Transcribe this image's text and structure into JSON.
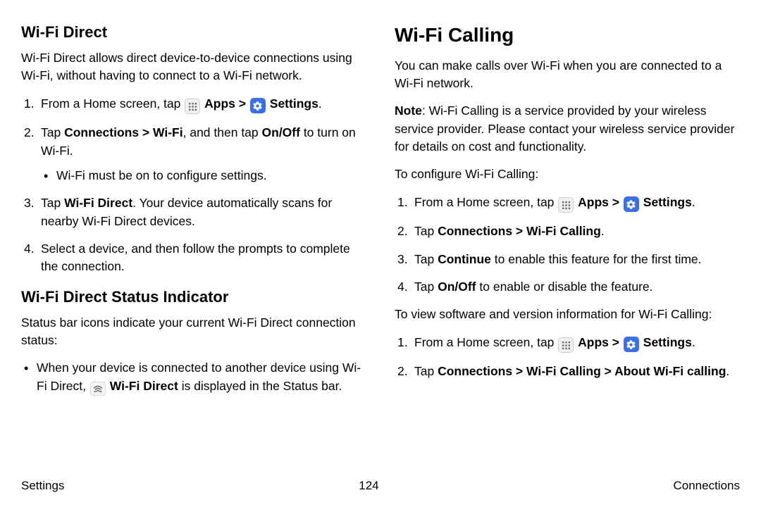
{
  "left": {
    "h_direct": "Wi-Fi Direct",
    "direct_intro": "Wi-Fi Direct allows direct device-to-device connections using Wi-Fi, without having to connect to a Wi-Fi network.",
    "step1_a": "From a Home screen, tap ",
    "apps_label": "Apps",
    "gt": ">",
    "settings_label": "Settings",
    "step2_a": "Tap ",
    "step2_b": "Connections > Wi-Fi",
    "step2_c": ", and then tap ",
    "step2_d": "On/Off",
    "step2_e": " to turn on Wi-Fi.",
    "step2_sub": "Wi-Fi must be on to configure settings.",
    "step3_a": "Tap ",
    "step3_b": "Wi-Fi Direct",
    "step3_c": ". Your device automatically scans for nearby Wi-Fi Direct devices.",
    "step4": "Select a device, and then follow the prompts to complete the connection.",
    "h_status": "Wi-Fi Direct Status Indicator",
    "status_intro": "Status bar icons indicate your current Wi-Fi Direct connection status:",
    "status_b1_a": "When your device is connected to another device using Wi-Fi Direct, ",
    "status_b1_b": "Wi-Fi Direct",
    "status_b1_c": " is displayed in the Status bar."
  },
  "right": {
    "h_calling": "Wi-Fi Calling",
    "calling_intro": "You can make calls over Wi-Fi when you are connected to a Wi-Fi network.",
    "note_label": "Note",
    "note_text": ": Wi-Fi Calling is a service provided by your wireless service provider. Please contact your wireless service provider for details on cost and functionality.",
    "config_intro": "To configure Wi-Fi Calling:",
    "c1_a": "From a Home screen, tap ",
    "apps_label": "Apps",
    "gt": ">",
    "settings_label": "Settings",
    "c2_a": "Tap ",
    "c2_b": "Connections > Wi-Fi Calling",
    "c3_a": "Tap ",
    "c3_b": "Continue",
    "c3_c": " to enable this feature for the first time.",
    "c4_a": "Tap ",
    "c4_b": "On/Off",
    "c4_c": " to enable or disable the feature.",
    "view_intro": "To view software and version information for Wi-Fi Calling:",
    "v1_a": "From a Home screen, tap ",
    "v2_a": "Tap ",
    "v2_b": "Connections > Wi-Fi Calling > About Wi-Fi calling"
  },
  "footer": {
    "left": "Settings",
    "center": "124",
    "right": "Connections"
  }
}
